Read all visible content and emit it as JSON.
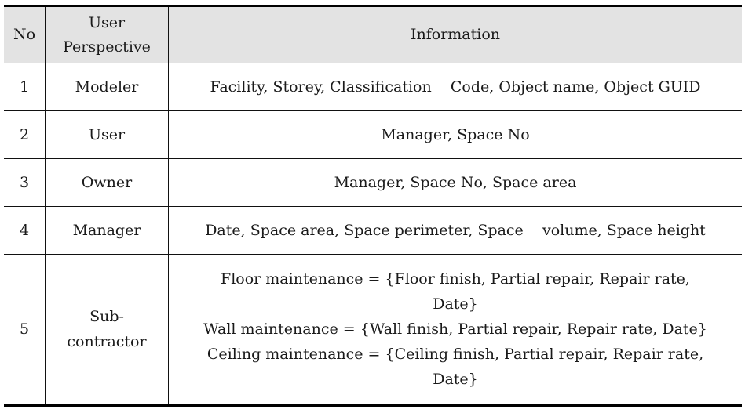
{
  "table": {
    "headers": {
      "no": "No",
      "user_perspective_line1": "User",
      "user_perspective_line2": "Perspective",
      "information": "Information"
    },
    "rows": [
      {
        "no": "1",
        "user": "Modeler",
        "information": "Facility, Storey, Classification    Code, Object name, Object GUID"
      },
      {
        "no": "2",
        "user": "User",
        "information": "Manager, Space No"
      },
      {
        "no": "3",
        "user": "Owner",
        "information": "Manager, Space No, Space area"
      },
      {
        "no": "4",
        "user": "Manager",
        "information": "Date, Space area, Space perimeter, Space    volume, Space height"
      },
      {
        "no": "5",
        "user_line1": "Sub-",
        "user_line2": "contractor",
        "information_lines": [
          "Floor maintenance = {Floor finish, Partial repair, Repair rate,",
          "Date}",
          "Wall maintenance = {Wall finish, Partial repair, Repair rate, Date}",
          "Ceiling maintenance = {Ceiling finish, Partial repair, Repair rate,",
          "Date}"
        ]
      }
    ]
  }
}
